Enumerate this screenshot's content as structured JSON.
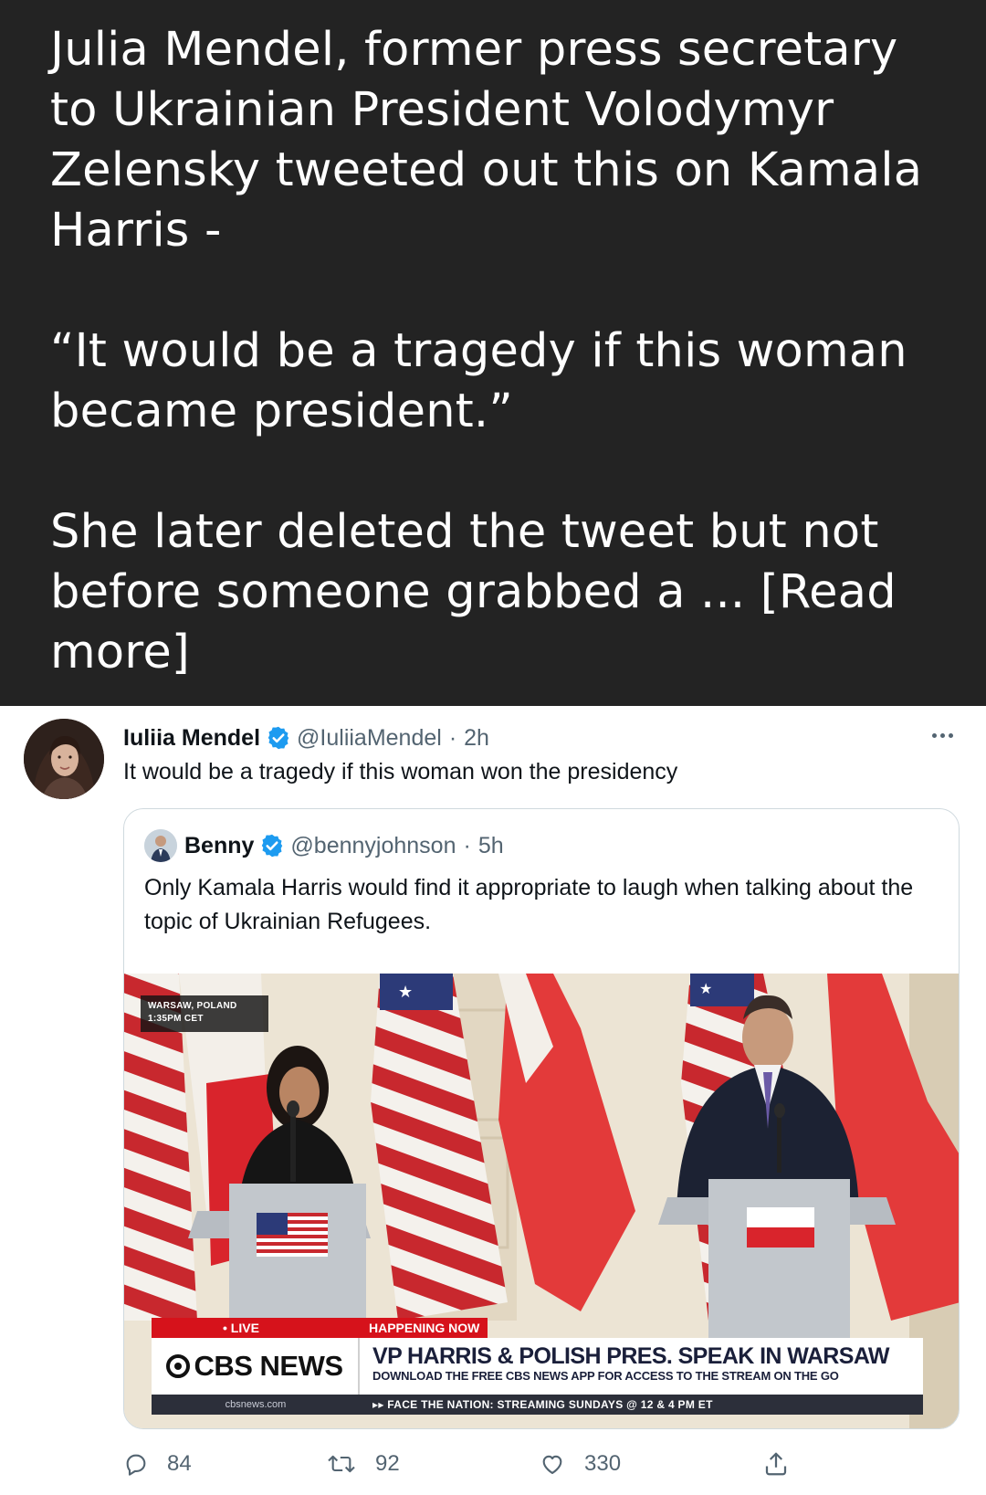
{
  "post": {
    "paragraph1": "Julia Mendel, former press secretary to Ukrainian President Volodymyr Zelensky tweeted out this on Kamala Harris -",
    "paragraph2": "“It would be a tragedy if this woman became president.”",
    "paragraph3": "She later deleted the tweet but not before someone grabbed a  ...",
    "read_more": "[Read more]"
  },
  "tweet": {
    "display_name": "Iuliia Mendel",
    "handle": "@IuliiaMendel",
    "separator": "·",
    "time": "2h",
    "text": "It would be a tragedy if this woman won the presidency",
    "quoted": {
      "display_name": "Benny",
      "handle": "@bennyjohnson",
      "separator": "·",
      "time": "5h",
      "text": "Only Kamala Harris would find it appropriate to laugh when talking about the topic of Ukrainian Refugees.",
      "image": {
        "location_line1": "WARSAW, POLAND",
        "location_line2": "1:35PM CET",
        "live_tag": "• LIVE",
        "happening_tag": "HAPPENING NOW",
        "network": "CBS NEWS",
        "headline": "VP HARRIS & POLISH PRES. SPEAK IN WARSAW",
        "subline": "DOWNLOAD THE FREE CBS NEWS APP FOR ACCESS TO THE STREAM ON THE GO",
        "site": "cbsnews.com",
        "ticker": "▸▸ FACE THE NATION: STREAMING SUNDAYS @ 12 & 4 PM ET"
      }
    },
    "actions": {
      "replies": "84",
      "retweets": "92",
      "likes": "330"
    }
  },
  "colors": {
    "post_background": "#232323",
    "verified_blue": "#1d9bf0",
    "secondary_text": "#536471",
    "cbs_red": "#d6121b"
  }
}
